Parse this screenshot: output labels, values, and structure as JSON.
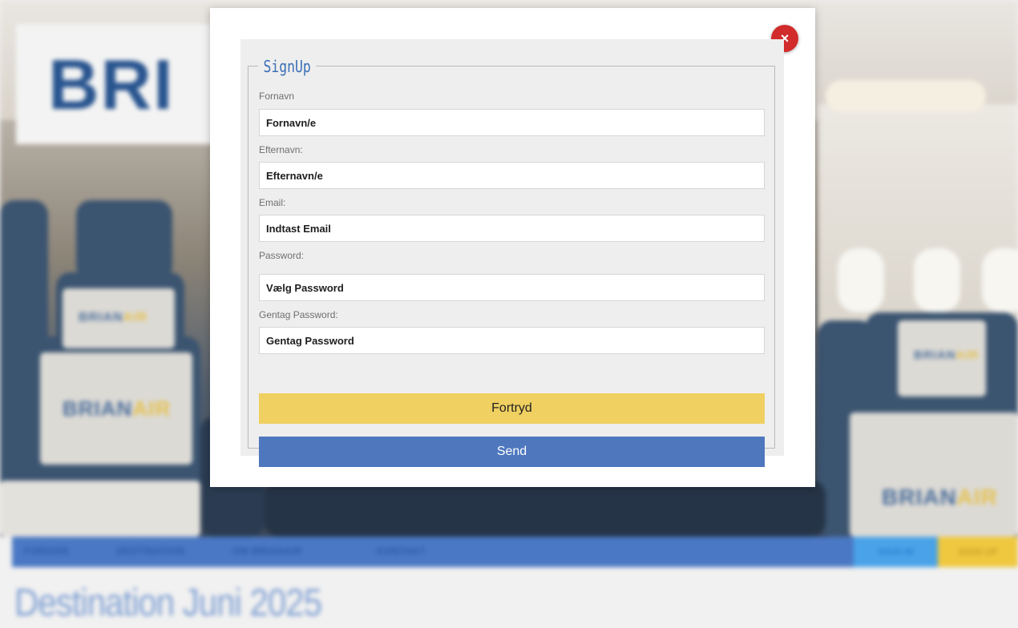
{
  "background": {
    "banner_text": "BRI",
    "seat_brand": "BRIAN",
    "seat_brand_accent": "AIR",
    "nav": {
      "items": [
        {
          "label": "FORSIDE"
        },
        {
          "label": "DESTINATION"
        },
        {
          "label": "OM BRIANAIR"
        },
        {
          "label": "KONTAKT"
        }
      ],
      "sign_in": "SIGN IN",
      "sign_up": "SIGN UP"
    },
    "page_heading": "Destination Juni 2025"
  },
  "modal": {
    "close_symbol": "×",
    "legend": "SignUp",
    "fields": {
      "first_name": {
        "label": "Fornavn",
        "placeholder": "Fornavn/e"
      },
      "last_name": {
        "label": "Efternavn:",
        "placeholder": "Efternavn/e"
      },
      "email": {
        "label": "Email:",
        "placeholder": "Indtast Email"
      },
      "password": {
        "label": "Password:",
        "placeholder": "Vælg Password"
      },
      "repeat_password": {
        "label": "Gentag Password:",
        "placeholder": "Gentag Password"
      }
    },
    "cancel_label": "Fortryd",
    "send_label": "Send"
  },
  "colors": {
    "accent_blue": "#4e77be",
    "accent_yellow": "#efd060",
    "close_red": "#d22b2b",
    "legend_blue": "#3a6fb5"
  }
}
